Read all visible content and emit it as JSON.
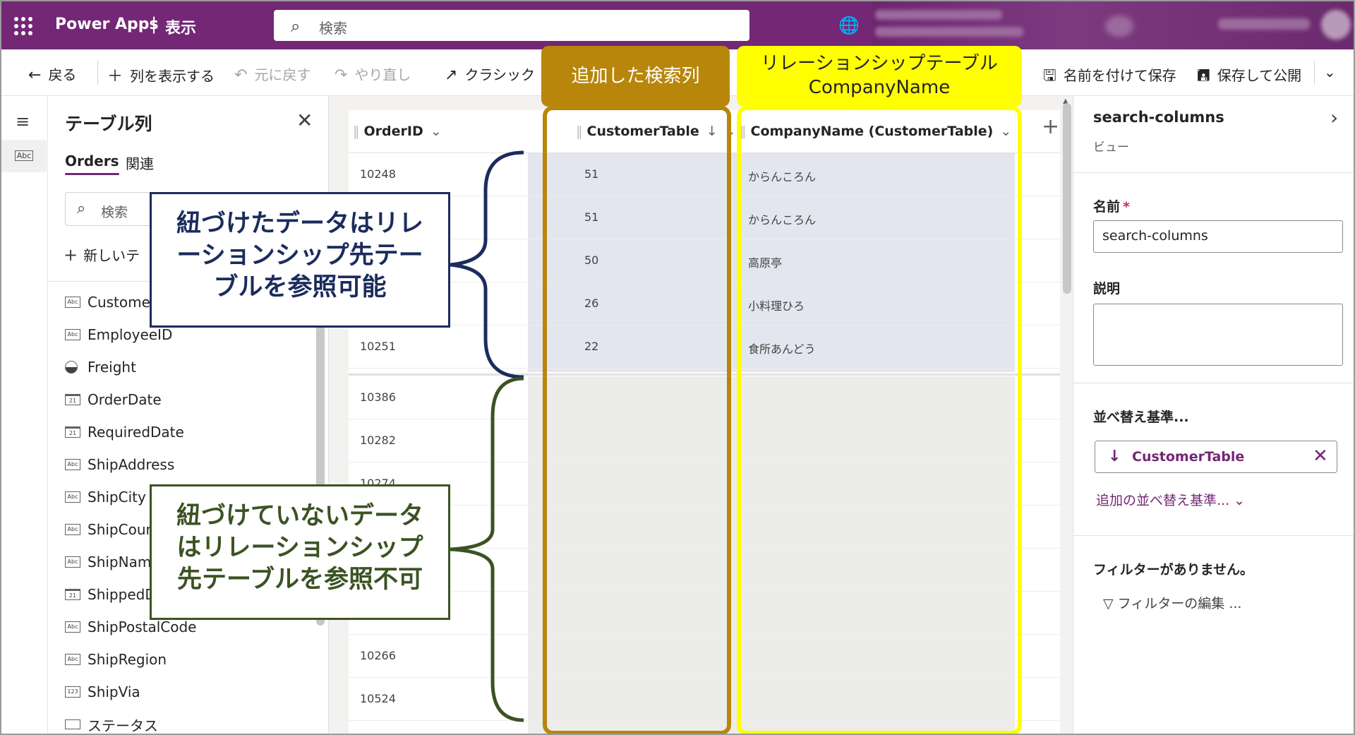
{
  "topbar": {
    "app_name": "Power Apps",
    "separator": "|",
    "view": "表示",
    "search_placeholder": "検索"
  },
  "toolbar": {
    "back": "戻る",
    "show_column": "列を表示する",
    "undo": "元に戻す",
    "redo": "やり直し",
    "classic": "クラシック",
    "save_as": "名前を付けて保存",
    "save_publish": "保存して公開"
  },
  "left_panel": {
    "title": "テーブル列",
    "tabs": [
      "Orders",
      "関連"
    ],
    "search_placeholder": "検索",
    "new_item": "新しいテ",
    "columns": [
      {
        "name": "Customer",
        "icon": "text-icon"
      },
      {
        "name": "EmployeeID",
        "icon": "text-icon"
      },
      {
        "name": "Freight",
        "icon": "currency-icon"
      },
      {
        "name": "OrderDate",
        "icon": "calendar-icon"
      },
      {
        "name": "RequiredDate",
        "icon": "calendar-icon"
      },
      {
        "name": "ShipAddress",
        "icon": "text-icon"
      },
      {
        "name": "ShipCity",
        "icon": "text-icon"
      },
      {
        "name": "ShipCoun",
        "icon": "text-icon"
      },
      {
        "name": "ShipName",
        "icon": "text-icon"
      },
      {
        "name": "ShippedD",
        "icon": "calendar-icon"
      },
      {
        "name": "ShipPostalCode",
        "icon": "text-icon"
      },
      {
        "name": "ShipRegion",
        "icon": "text-icon"
      },
      {
        "name": "ShipVia",
        "icon": "number-icon"
      },
      {
        "name": "ステータス",
        "icon": "toggle-icon"
      }
    ]
  },
  "grid": {
    "headers": {
      "order_id": "OrderID",
      "customer_table": "CustomerTable",
      "company_name": "CompanyName (CustomerTable)"
    },
    "rows": [
      {
        "order_id": "10248",
        "customer": "51",
        "company": "からんころん"
      },
      {
        "order_id": "",
        "customer": "51",
        "company": "からんころん"
      },
      {
        "order_id": "",
        "customer": "50",
        "company": "高原亭"
      },
      {
        "order_id": "",
        "customer": "26",
        "company": "小料理ひろ"
      },
      {
        "order_id": "10251",
        "customer": "22",
        "company": "食所あんどう"
      },
      {
        "order_id": "10386",
        "customer": "",
        "company": ""
      },
      {
        "order_id": "10282",
        "customer": "",
        "company": ""
      },
      {
        "order_id": "10274",
        "customer": "",
        "company": ""
      },
      {
        "order_id": "",
        "customer": "",
        "company": ""
      },
      {
        "order_id": "",
        "customer": "",
        "company": ""
      },
      {
        "order_id": "",
        "customer": "",
        "company": ""
      },
      {
        "order_id": "10266",
        "customer": "",
        "company": ""
      },
      {
        "order_id": "10524",
        "customer": "",
        "company": ""
      }
    ]
  },
  "right_panel": {
    "title": "search-columns",
    "subtitle": "ビュー",
    "name_label": "名前",
    "required_mark": "*",
    "name_value": "search-columns",
    "description_label": "説明",
    "sort_label": "並べ替え基準...",
    "sort_value": "CustomerTable",
    "add_sort": "追加の並べ替え基準...",
    "no_filter": "フィルターがありません。",
    "edit_filter": "フィルターの編集 ..."
  },
  "annotations": {
    "added_lookup": "追加した検索列",
    "relationship_line1": "リレーションシップテーブル",
    "relationship_line2": "CompanyName",
    "linked_note": "紐づけたデータはリレーションシップ先テーブルを参照可能",
    "unlinked_note": "紐づけていないデータはリレーションシップ先テーブルを参照不可"
  },
  "colors": {
    "brand": "#742774",
    "gold": "#b8860b",
    "yellow": "#ffff00",
    "navy": "#1b2c5c",
    "green": "#3b5323"
  }
}
